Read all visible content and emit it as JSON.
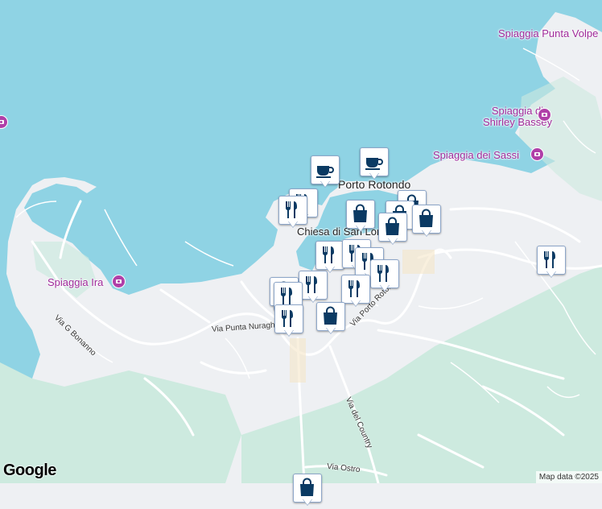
{
  "map": {
    "colors": {
      "water": "#8fd3e4",
      "land": "#eef0f3",
      "green": "#cdeadf",
      "road": "#ffffff",
      "marker_icon": "#0b3a63"
    },
    "places": [
      {
        "id": "porto-rotondo",
        "label": "Porto Rotondo"
      },
      {
        "id": "chiesa",
        "label": "Chiesa di San Lorenzo"
      }
    ],
    "pois": [
      {
        "id": "spiaggia-punta-volpe",
        "label": "Spiaggia Punta Volpe"
      },
      {
        "id": "spiaggia-shirley-bassey",
        "label": "Spiaggia di\nShirley Bassey"
      },
      {
        "id": "spiaggia-dei-sassi",
        "label": "Spiaggia dei Sassi"
      },
      {
        "id": "spiaggia-ira",
        "label": "Spiaggia Ira"
      }
    ],
    "roads": [
      {
        "id": "via-g-bonanno",
        "label": "Via G Bonanno"
      },
      {
        "id": "via-punta-nuraghe",
        "label": "Via Punta Nuraghe"
      },
      {
        "id": "via-porto-rotondo",
        "label": "Via Porto Rotondo"
      },
      {
        "id": "via-del-country",
        "label": "Via del Country"
      },
      {
        "id": "via-ostro",
        "label": "Via Ostro"
      }
    ],
    "markers": [
      {
        "type": "cafe-icon"
      },
      {
        "type": "cafe-icon"
      },
      {
        "type": "restaurant-icon"
      },
      {
        "type": "restaurant-icon"
      },
      {
        "type": "shopping-bag-icon"
      },
      {
        "type": "shopping-bag-icon"
      },
      {
        "type": "shopping-bag-icon"
      },
      {
        "type": "shopping-bag-icon"
      },
      {
        "type": "shopping-bag-icon"
      },
      {
        "type": "restaurant-icon"
      },
      {
        "type": "restaurant-icon"
      },
      {
        "type": "restaurant-icon"
      },
      {
        "type": "restaurant-icon"
      },
      {
        "type": "restaurant-icon"
      },
      {
        "type": "restaurant-icon"
      },
      {
        "type": "shopping-bag-icon"
      },
      {
        "type": "restaurant-icon"
      },
      {
        "type": "restaurant-icon"
      },
      {
        "type": "shopping-bag-icon"
      },
      {
        "type": "restaurant-icon"
      }
    ]
  },
  "branding": {
    "logo": "Google",
    "attribution": "Map data ©2025"
  }
}
